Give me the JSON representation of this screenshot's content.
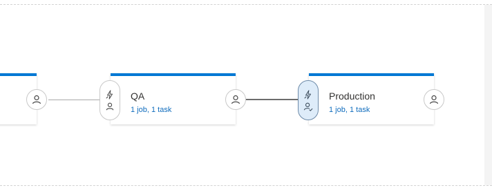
{
  "pipeline": {
    "stages": [
      {
        "name": "",
        "jobs": ""
      },
      {
        "name": "QA",
        "jobs": "1 job, 1 task"
      },
      {
        "name": "Production",
        "jobs": "1 job, 1 task"
      }
    ]
  },
  "icons": {
    "trigger": "lightning-icon",
    "pre_approver": "person-icon",
    "post_approver": "person-icon",
    "pending_approver": "person-check-icon"
  },
  "colors": {
    "accent": "#0078d4",
    "link": "#0f6cbd",
    "active_gate_bg": "#deecf9"
  }
}
